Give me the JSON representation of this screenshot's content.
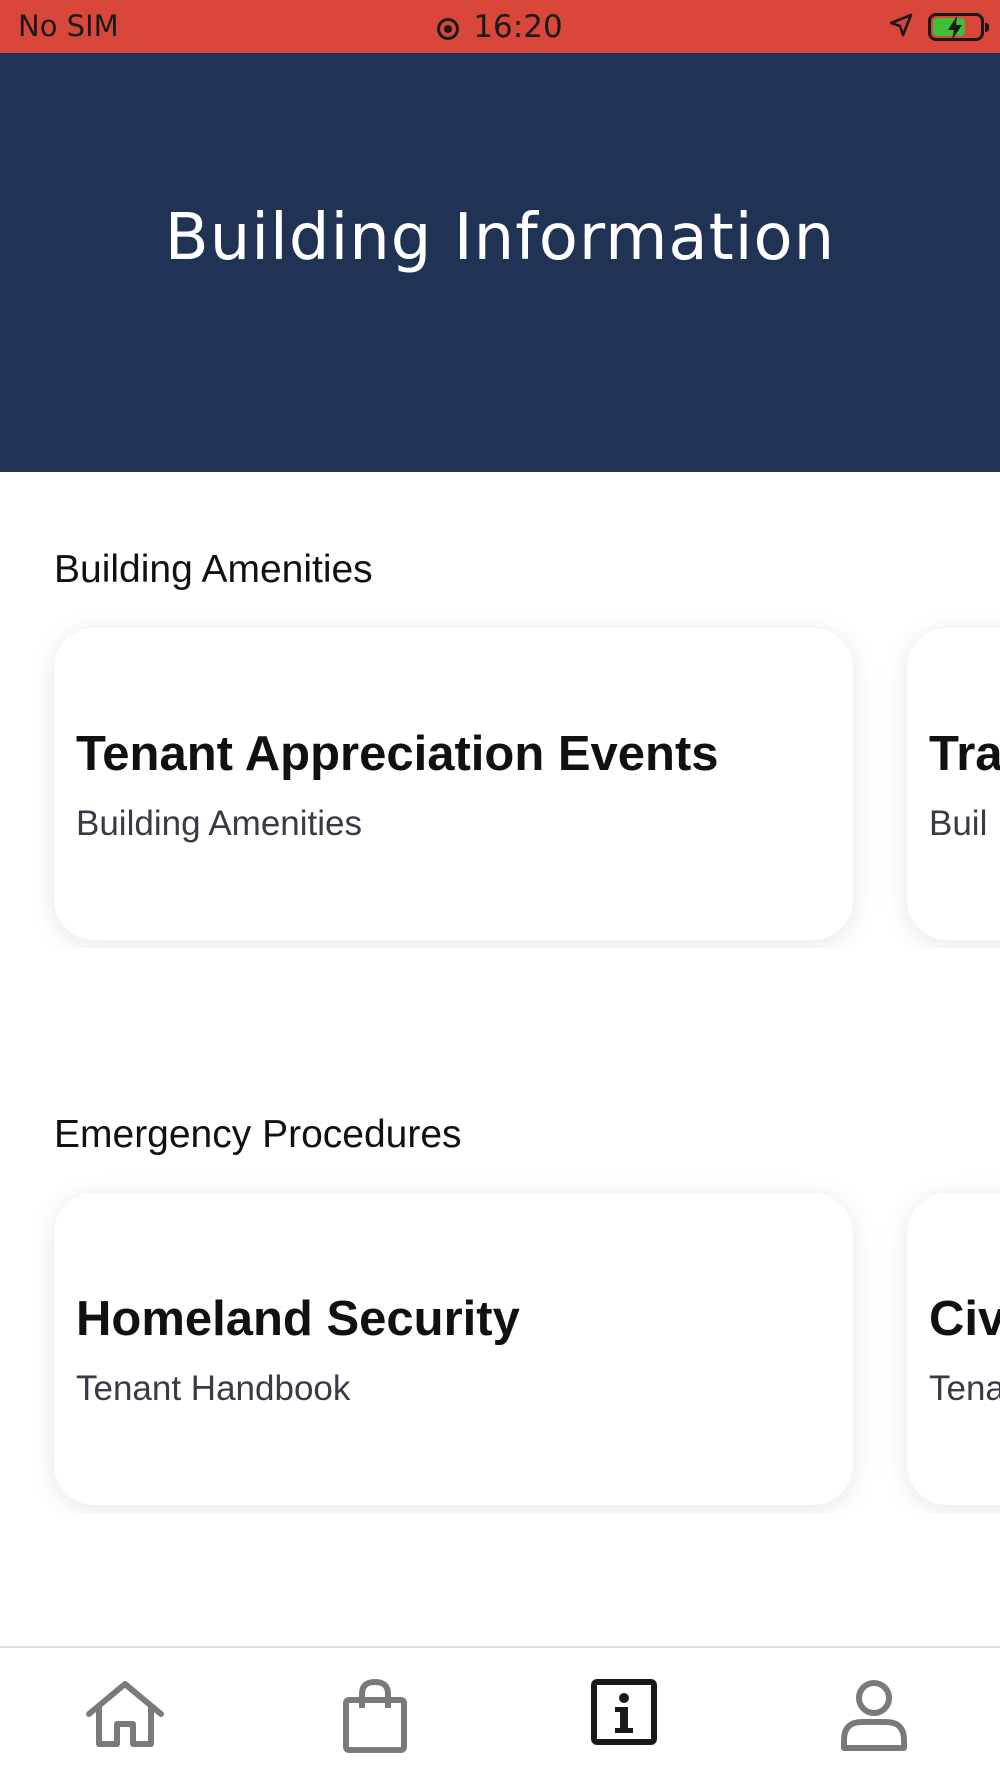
{
  "status_bar": {
    "carrier": "No SIM",
    "time": "16:20",
    "battery_level": 0.7,
    "battery_charging": true,
    "background_color": "#d9473a"
  },
  "header": {
    "title": "Building Information",
    "background_color": "#203354"
  },
  "sections": [
    {
      "title": "Building Amenities",
      "cards": [
        {
          "title": "Tenant Appreciation Events",
          "subtitle": "Building Amenities"
        },
        {
          "title": "Tra",
          "subtitle": "Buil"
        }
      ]
    },
    {
      "title": "Emergency Procedures",
      "cards": [
        {
          "title": "Homeland Security",
          "subtitle": "Tenant Handbook"
        },
        {
          "title": "Civ",
          "subtitle": "Tena"
        }
      ]
    }
  ],
  "tab_bar": {
    "items": [
      {
        "icon": "home-icon",
        "active": false
      },
      {
        "icon": "shopping-bag-icon",
        "active": false
      },
      {
        "icon": "info-icon",
        "active": true
      },
      {
        "icon": "profile-icon",
        "active": false
      }
    ],
    "active_color": "#1a1a1a",
    "inactive_color": "#7a7a7a"
  }
}
